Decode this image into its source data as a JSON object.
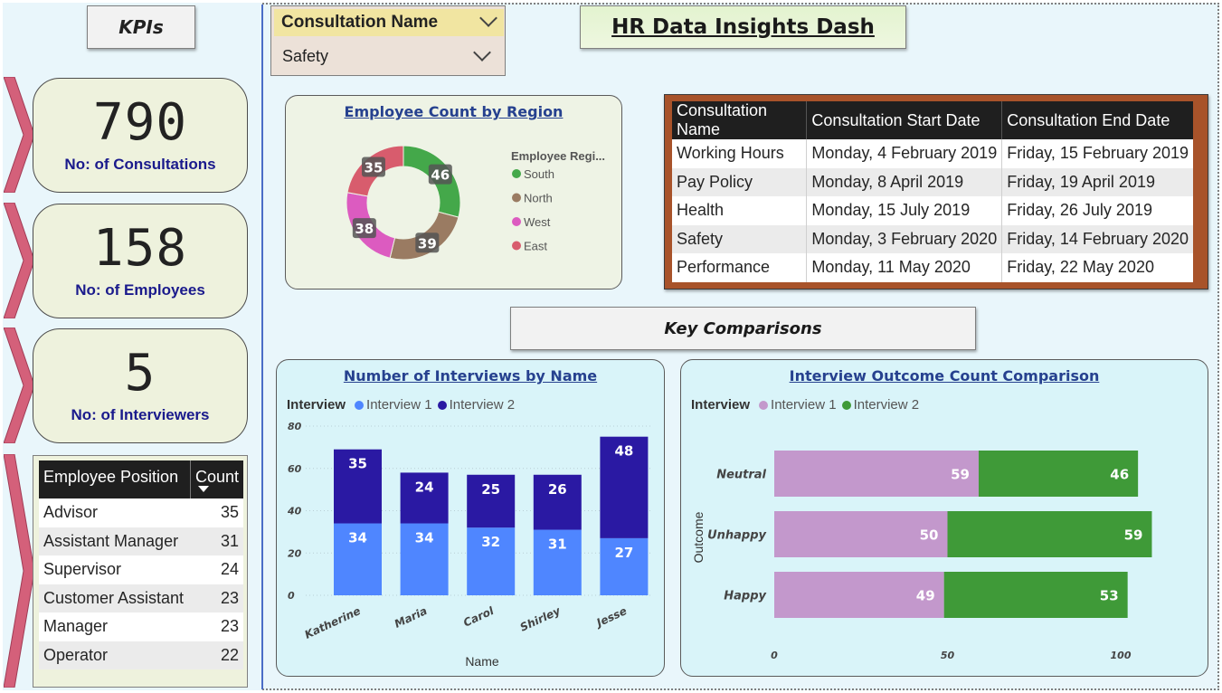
{
  "kpis_title": "KPIs",
  "kpis": [
    {
      "value": "790",
      "label": "No: of Consultations"
    },
    {
      "value": "158",
      "label": "No: of Employees"
    },
    {
      "value": "5",
      "label": "No: of Interviewers"
    }
  ],
  "positions": {
    "headers": [
      "Employee Position",
      "Count"
    ],
    "rows": [
      {
        "name": "Advisor",
        "count": "35"
      },
      {
        "name": "Assistant Manager",
        "count": "31"
      },
      {
        "name": "Supervisor",
        "count": "24"
      },
      {
        "name": "Customer Assistant",
        "count": "23"
      },
      {
        "name": "Manager",
        "count": "23"
      },
      {
        "name": "Operator",
        "count": "22"
      }
    ]
  },
  "slicer": {
    "title": "Consultation Name",
    "value": "Safety"
  },
  "dashboard_title": "HR Data Insights Dash",
  "consultations": {
    "headers": [
      "Consultation Name",
      "Consultation Start Date",
      "Consultation End Date"
    ],
    "rows": [
      [
        "Working Hours",
        "Monday, 4 February 2019",
        "Friday, 15 February 2019"
      ],
      [
        "Pay Policy",
        "Monday, 8 April 2019",
        "Friday, 19 April 2019"
      ],
      [
        "Health",
        "Monday, 15 July 2019",
        "Friday, 26 July 2019"
      ],
      [
        "Safety",
        "Monday, 3 February 2020",
        "Friday, 14 February 2020"
      ],
      [
        "Performance",
        "Monday, 11 May 2020",
        "Friday, 22 May 2020"
      ]
    ]
  },
  "key_comparisons": "Key Comparisons",
  "colors": {
    "south": "#44a84a",
    "north": "#9a7b62",
    "west": "#dc5bc0",
    "east": "#d85c6d",
    "interview1_bar": "#4f86ff",
    "interview2_bar": "#2a19a3",
    "interview1_outcome": "#c398cc",
    "interview2_outcome": "#3f9a38"
  },
  "chart_data": [
    {
      "type": "pie",
      "title": "Employee Count by Region",
      "legend_title": "Employee Regi...",
      "categories": [
        "South",
        "North",
        "West",
        "East"
      ],
      "values": [
        46,
        39,
        38,
        35
      ]
    },
    {
      "type": "bar",
      "title": "Number of Interviews by Name",
      "legend_title": "Interview",
      "categories": [
        "Katherine",
        "Maria",
        "Carol",
        "Shirley",
        "Jesse"
      ],
      "series": [
        {
          "name": "Interview 1",
          "values": [
            34,
            34,
            32,
            31,
            27
          ]
        },
        {
          "name": "Interview 2",
          "values": [
            35,
            24,
            25,
            26,
            48
          ]
        }
      ],
      "xlabel": "Name",
      "ylim": [
        0,
        80
      ],
      "yticks": [
        "80",
        "60",
        "40",
        "20",
        "0"
      ]
    },
    {
      "type": "bar",
      "title": "Interview Outcome Count Comparison",
      "legend_title": "Interview",
      "categories": [
        "Neutral",
        "Unhappy",
        "Happy"
      ],
      "series": [
        {
          "name": "Interview 1",
          "values": [
            59,
            50,
            49
          ]
        },
        {
          "name": "Interview 2",
          "values": [
            46,
            59,
            53
          ]
        }
      ],
      "ylabel": "Outcome",
      "xlim": [
        0,
        105
      ],
      "xticks": [
        "0",
        "50",
        "100"
      ]
    }
  ]
}
